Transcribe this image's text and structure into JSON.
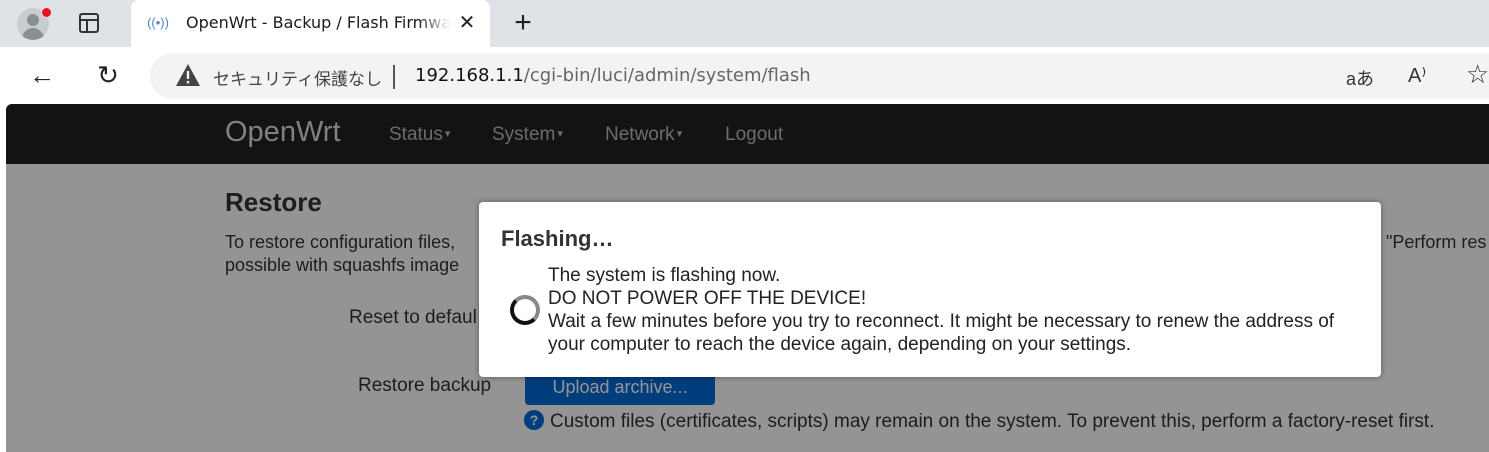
{
  "browser": {
    "tab": {
      "title": "OpenWrt - Backup / Flash Firmware - LuCI",
      "favicon": "broadcast-icon",
      "close_glyph": "✕"
    },
    "new_tab_glyph": "+",
    "nav": {
      "back_glyph": "←",
      "reload_glyph": "↻"
    },
    "address": {
      "security_label": "セキュリティ保護なし",
      "url_host": "192.168.1.1",
      "url_path": "/cgi-bin/luci/admin/system/flash"
    },
    "toolbar": {
      "translate_glyph": "aあ",
      "read_aloud_glyph": "A⁾",
      "favorite_glyph": "☆"
    }
  },
  "luci": {
    "brand": "OpenWrt",
    "menu": [
      {
        "label": "Status",
        "caret": "▾"
      },
      {
        "label": "System",
        "caret": "▾"
      },
      {
        "label": "Network",
        "caret": "▾"
      },
      {
        "label": "Logout"
      }
    ]
  },
  "restore": {
    "title": "Restore",
    "description_visible_line1": "To restore configuration files,",
    "description_visible_line1_right": "\"Perform res",
    "description_visible_line2": "possible with squashfs image",
    "reset_label": "Reset to defaul",
    "restore_label": "Restore backup",
    "upload_button": "Upload archive...",
    "help_glyph": "?",
    "help_text": "Custom files (certificates, scripts) may remain on the system. To prevent this, perform a factory-reset first."
  },
  "modal": {
    "title": "Flashing…",
    "lines": [
      "The system is flashing now.",
      "DO NOT POWER OFF THE DEVICE!",
      "Wait a few minutes before you try to reconnect. It might be necessary to renew the address of",
      "your computer to reach the device again, depending on your settings."
    ]
  },
  "colors": {
    "luci_header": "#222222",
    "primary_button": "#0069d6",
    "overlay": "rgba(0,0,0,0.42)"
  }
}
